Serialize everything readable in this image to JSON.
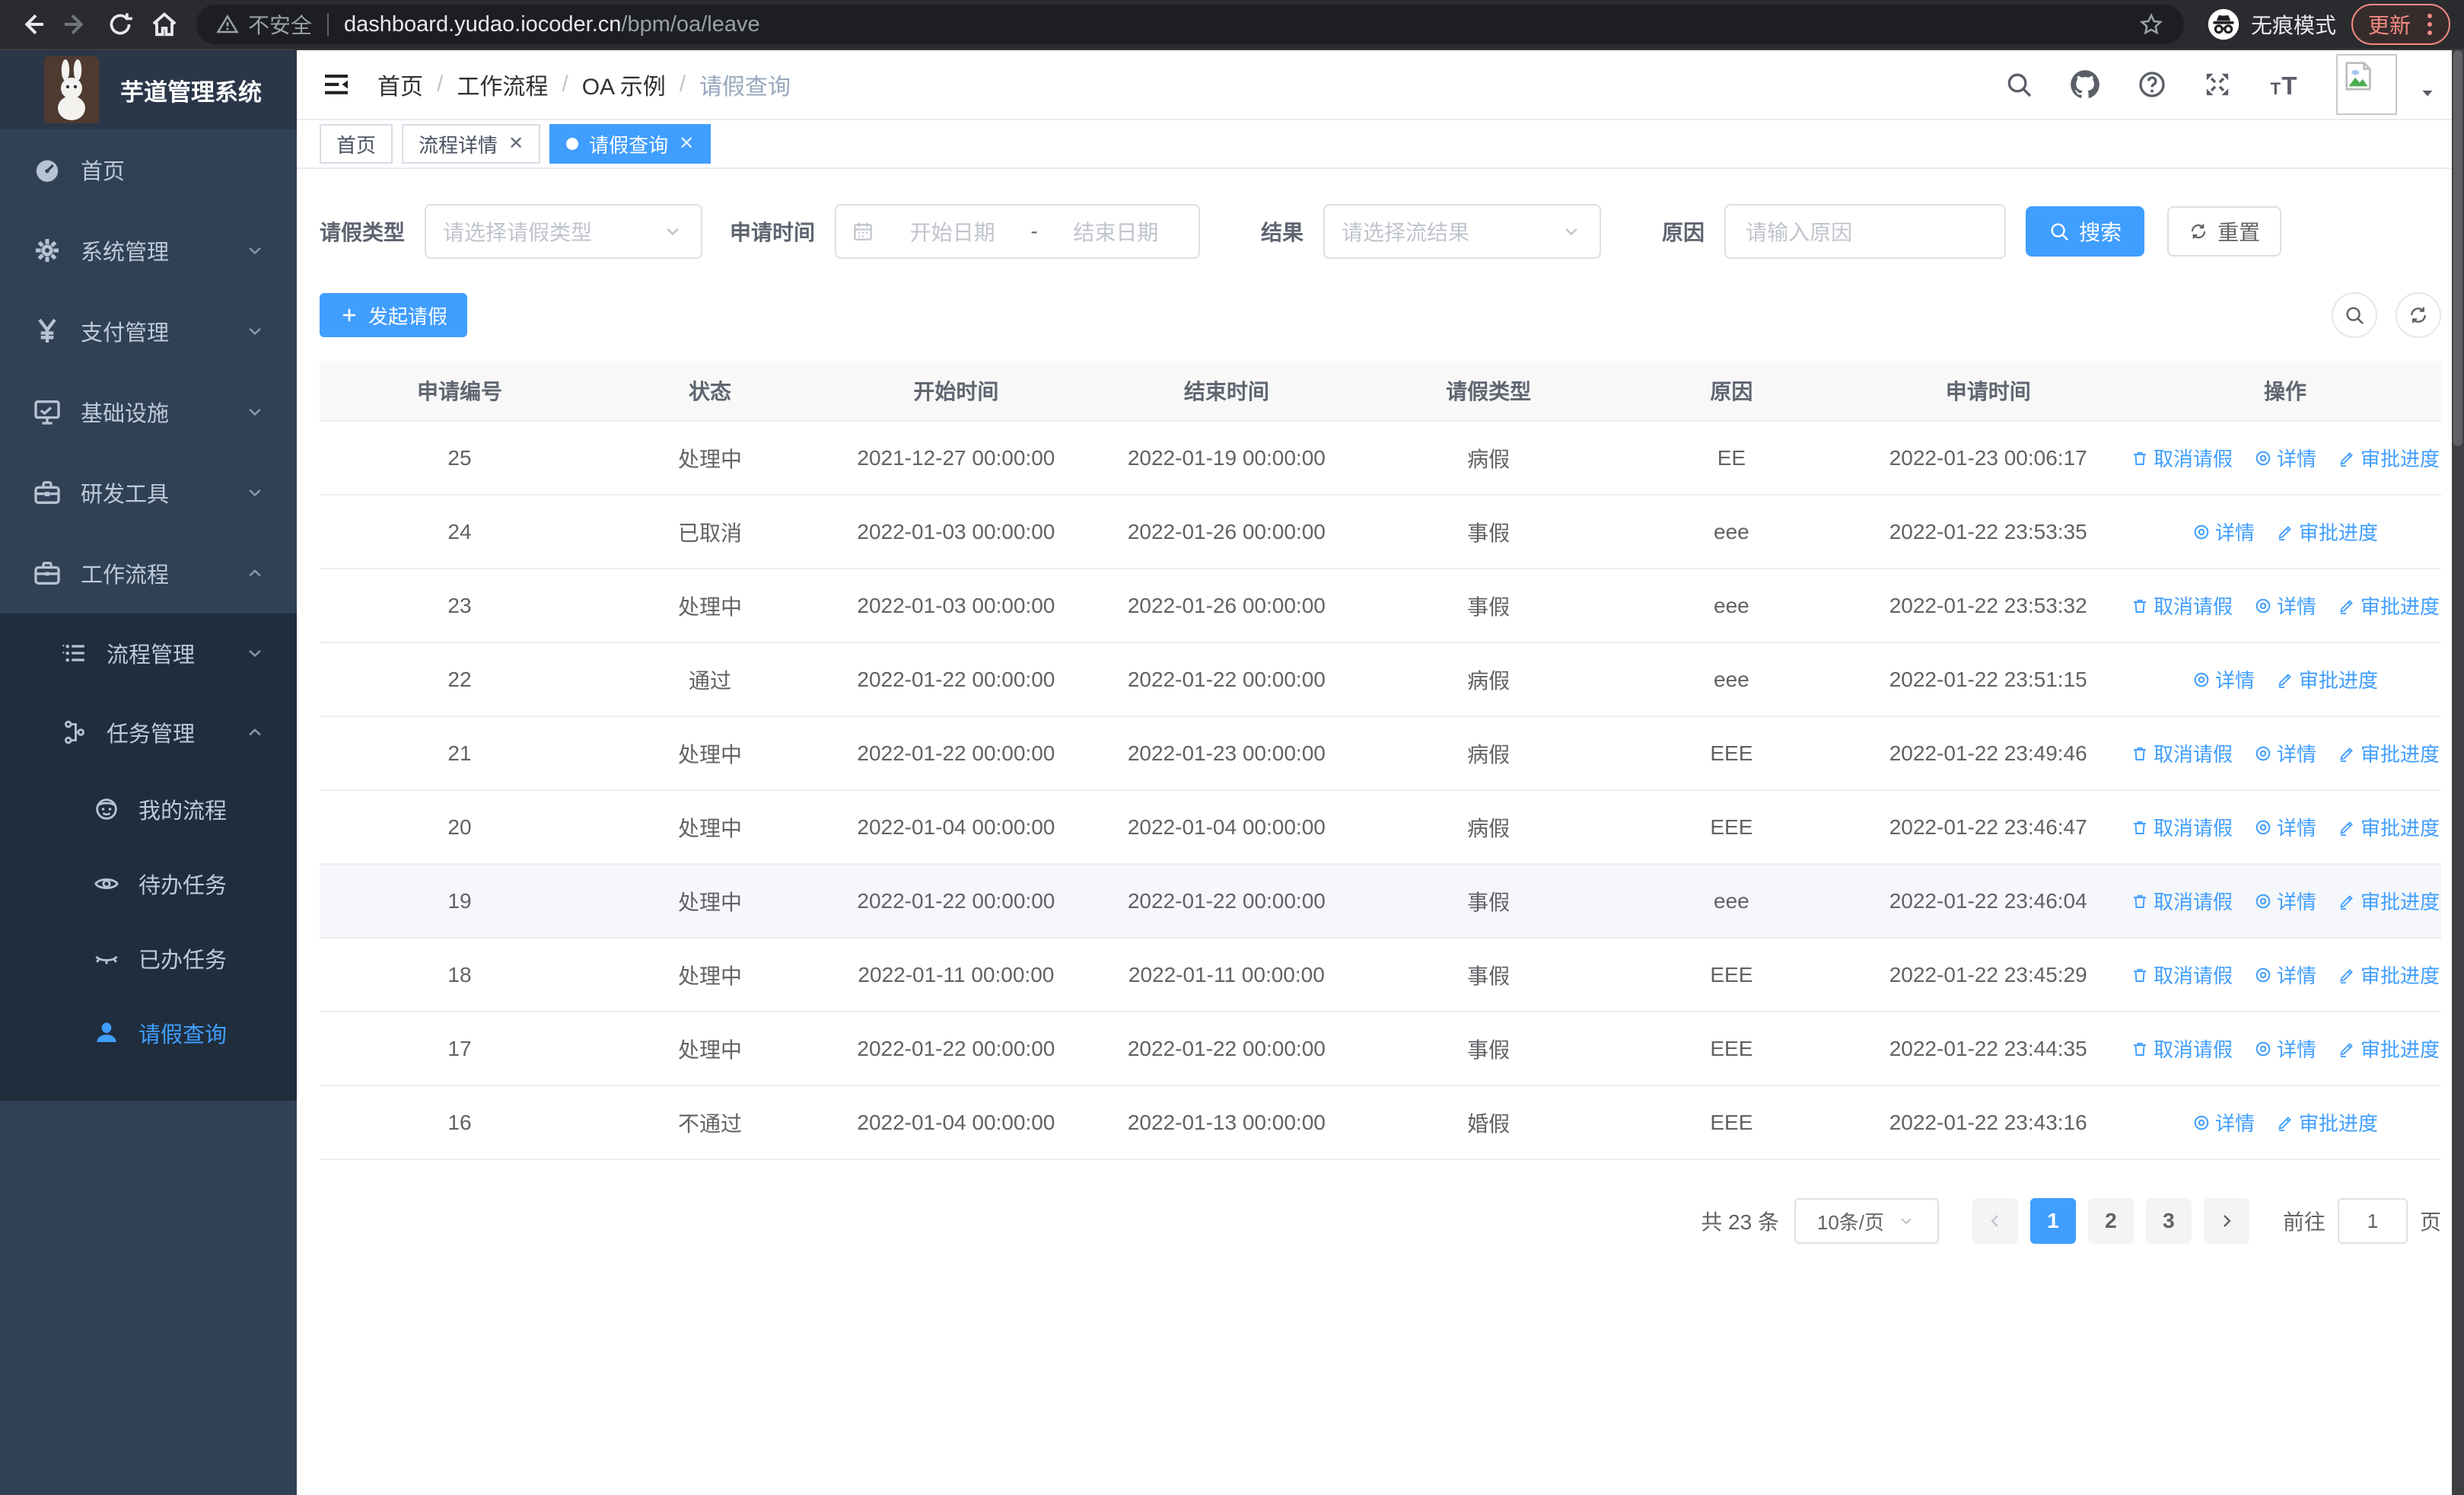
{
  "browser": {
    "security_label": "不安全",
    "url_host": "dashboard.yudao.iocoder.cn",
    "url_path": "/bpm/oa/leave",
    "incognito_label": "无痕模式",
    "update_label": "更新"
  },
  "sidebar": {
    "title": "芋道管理系统",
    "menu": [
      {
        "id": "home",
        "icon": "dashboard-icon",
        "label": "首页"
      },
      {
        "id": "system",
        "icon": "gear-icon",
        "label": "系统管理",
        "chevron": "down"
      },
      {
        "id": "payment",
        "icon": "yen-icon",
        "label": "支付管理",
        "chevron": "down"
      },
      {
        "id": "infra",
        "icon": "monitor-icon",
        "label": "基础设施",
        "chevron": "down"
      },
      {
        "id": "devtools",
        "icon": "toolbox-icon",
        "label": "研发工具",
        "chevron": "down"
      },
      {
        "id": "workflow",
        "icon": "briefcase-icon",
        "label": "工作流程",
        "chevron": "up",
        "children": [
          {
            "id": "process-mgmt",
            "icon": "list-icon",
            "label": "流程管理",
            "chevron": "down"
          },
          {
            "id": "task-mgmt",
            "icon": "tree-icon",
            "label": "任务管理",
            "chevron": "up",
            "children": [
              {
                "id": "my-process",
                "icon": "smiley-icon",
                "label": "我的流程"
              },
              {
                "id": "todo-tasks",
                "icon": "eye-icon",
                "label": "待办任务"
              },
              {
                "id": "done-tasks",
                "icon": "eye-closed-icon",
                "label": "已办任务"
              },
              {
                "id": "leave-query",
                "icon": "user-icon",
                "label": "请假查询",
                "active": true
              }
            ]
          }
        ]
      }
    ]
  },
  "header": {
    "breadcrumb": [
      "首页",
      "工作流程",
      "OA 示例",
      "请假查询"
    ]
  },
  "tabbar": {
    "tabs": [
      {
        "label": "首页",
        "closable": false,
        "active": false
      },
      {
        "label": "流程详情",
        "closable": true,
        "active": false
      },
      {
        "label": "请假查询",
        "closable": true,
        "active": true
      }
    ]
  },
  "filters": {
    "leave_type_label": "请假类型",
    "leave_type_placeholder": "请选择请假类型",
    "apply_time_label": "申请时间",
    "start_placeholder": "开始日期",
    "range_separator": "-",
    "end_placeholder": "结束日期",
    "result_label": "结果",
    "result_placeholder": "请选择流结果",
    "reason_label": "原因",
    "reason_placeholder": "请输入原因",
    "search_label": "搜索",
    "reset_label": "重置"
  },
  "toolbar": {
    "create_label": "发起请假"
  },
  "table": {
    "columns": [
      "申请编号",
      "状态",
      "开始时间",
      "结束时间",
      "请假类型",
      "原因",
      "申请时间",
      "操作"
    ],
    "action_labels": {
      "cancel": "取消请假",
      "detail": "详情",
      "progress": "审批进度"
    },
    "rows": [
      {
        "id": "25",
        "status": "处理中",
        "start": "2021-12-27 00:00:00",
        "end": "2022-01-19 00:00:00",
        "type": "病假",
        "reason": "EE",
        "apply_time": "2022-01-23 00:06:17",
        "actions": [
          "cancel",
          "detail",
          "progress"
        ],
        "highlighted": false
      },
      {
        "id": "24",
        "status": "已取消",
        "start": "2022-01-03 00:00:00",
        "end": "2022-01-26 00:00:00",
        "type": "事假",
        "reason": "eee",
        "apply_time": "2022-01-22 23:53:35",
        "actions": [
          "detail",
          "progress"
        ],
        "highlighted": false
      },
      {
        "id": "23",
        "status": "处理中",
        "start": "2022-01-03 00:00:00",
        "end": "2022-01-26 00:00:00",
        "type": "事假",
        "reason": "eee",
        "apply_time": "2022-01-22 23:53:32",
        "actions": [
          "cancel",
          "detail",
          "progress"
        ],
        "highlighted": false
      },
      {
        "id": "22",
        "status": "通过",
        "start": "2022-01-22 00:00:00",
        "end": "2022-01-22 00:00:00",
        "type": "病假",
        "reason": "eee",
        "apply_time": "2022-01-22 23:51:15",
        "actions": [
          "detail",
          "progress"
        ],
        "highlighted": false
      },
      {
        "id": "21",
        "status": "处理中",
        "start": "2022-01-22 00:00:00",
        "end": "2022-01-23 00:00:00",
        "type": "病假",
        "reason": "EEE",
        "apply_time": "2022-01-22 23:49:46",
        "actions": [
          "cancel",
          "detail",
          "progress"
        ],
        "highlighted": false
      },
      {
        "id": "20",
        "status": "处理中",
        "start": "2022-01-04 00:00:00",
        "end": "2022-01-04 00:00:00",
        "type": "病假",
        "reason": "EEE",
        "apply_time": "2022-01-22 23:46:47",
        "actions": [
          "cancel",
          "detail",
          "progress"
        ],
        "highlighted": false
      },
      {
        "id": "19",
        "status": "处理中",
        "start": "2022-01-22 00:00:00",
        "end": "2022-01-22 00:00:00",
        "type": "事假",
        "reason": "eee",
        "apply_time": "2022-01-22 23:46:04",
        "actions": [
          "cancel",
          "detail",
          "progress"
        ],
        "highlighted": true
      },
      {
        "id": "18",
        "status": "处理中",
        "start": "2022-01-11 00:00:00",
        "end": "2022-01-11 00:00:00",
        "type": "事假",
        "reason": "EEE",
        "apply_time": "2022-01-22 23:45:29",
        "actions": [
          "cancel",
          "detail",
          "progress"
        ],
        "highlighted": false
      },
      {
        "id": "17",
        "status": "处理中",
        "start": "2022-01-22 00:00:00",
        "end": "2022-01-22 00:00:00",
        "type": "事假",
        "reason": "EEE",
        "apply_time": "2022-01-22 23:44:35",
        "actions": [
          "cancel",
          "detail",
          "progress"
        ],
        "highlighted": false
      },
      {
        "id": "16",
        "status": "不通过",
        "start": "2022-01-04 00:00:00",
        "end": "2022-01-13 00:00:00",
        "type": "婚假",
        "reason": "EEE",
        "apply_time": "2022-01-22 23:43:16",
        "actions": [
          "detail",
          "progress"
        ],
        "highlighted": false
      }
    ]
  },
  "pagination": {
    "total_text": "共 23 条",
    "page_size_label": "10条/页",
    "pages": [
      "1",
      "2",
      "3"
    ],
    "active_page": "1",
    "goto_label": "前往",
    "goto_value": "1",
    "goto_unit": "页"
  },
  "colors": {
    "accent": "#409eff",
    "sidebar_bg": "#304156",
    "submenu_bg": "#1f2d3d"
  }
}
